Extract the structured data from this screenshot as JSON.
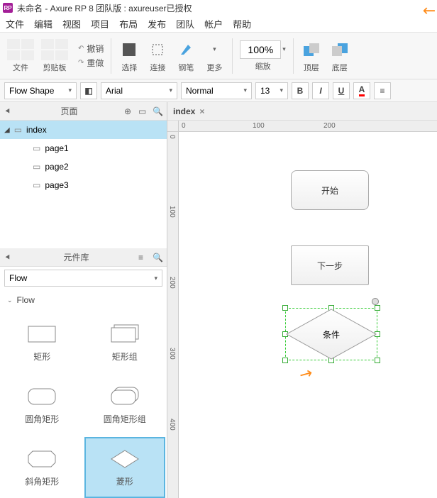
{
  "title": "未命名 - Axure RP 8 团队版 : axureuser已授权",
  "menu": [
    "文件",
    "编辑",
    "视图",
    "项目",
    "布局",
    "发布",
    "团队",
    "帐户",
    "帮助"
  ],
  "toolbar": {
    "file": "文件",
    "clipboard": "剪贴板",
    "undo": "撤销",
    "redo": "重做",
    "select": "选择",
    "connect": "连接",
    "pen": "钢笔",
    "more": "更多",
    "zoom": "缩放",
    "zoom_val": "100%",
    "top": "顶层",
    "bottom": "底层"
  },
  "format": {
    "shape": "Flow Shape",
    "font": "Arial",
    "weight": "Normal",
    "size": "13"
  },
  "panels": {
    "pages": "页面",
    "lib": "元件库",
    "flow_select": "Flow",
    "flow_cat": "Flow"
  },
  "pages": {
    "root": "index",
    "items": [
      "page1",
      "page2",
      "page3"
    ]
  },
  "shapes": {
    "rect": "矩形",
    "rectgroup": "矩形组",
    "roundrect": "圆角矩形",
    "roundrectgroup": "圆角矩形组",
    "bevel": "斜角矩形",
    "diamond": "菱形"
  },
  "canvas": {
    "tab": "index",
    "start": "开始",
    "next": "下一步",
    "cond": "条件",
    "ruler_h": [
      "0",
      "100",
      "200"
    ],
    "ruler_v": [
      "0",
      "100",
      "200",
      "300",
      "400"
    ]
  }
}
